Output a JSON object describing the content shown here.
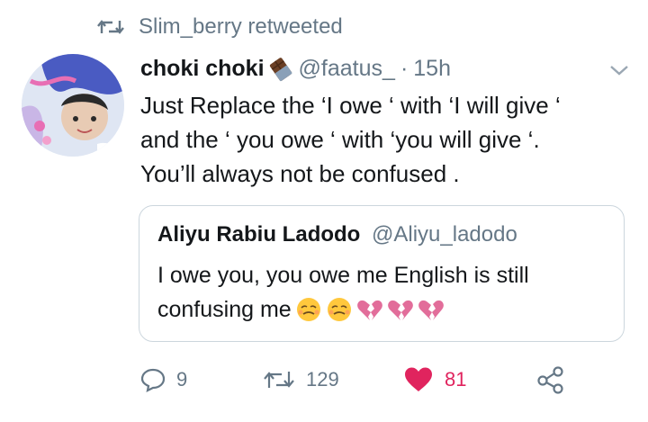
{
  "retweet_banner": {
    "text": "Slim_berry retweeted"
  },
  "tweet": {
    "author_name": "choki choki",
    "author_emoji": "chocolate-bar-icon",
    "handle": "@faatus_",
    "separator": "·",
    "time": "15h",
    "text_lines": [
      "Just Replace the ‘I owe ‘ with ‘I will give ‘",
      "and the ‘ you owe ‘ with ‘you will give ‘.",
      "You’ll always not be confused ."
    ]
  },
  "quoted_tweet": {
    "author_name": "Aliyu Rabiu Ladodo",
    "handle": "@Aliyu_ladodo",
    "text_line_1": "I owe you, you owe me English is still",
    "text_line_2": "confusing me",
    "emojis": [
      "pleading-face-icon",
      "pleading-face-icon",
      "broken-heart-icon",
      "broken-heart-icon",
      "broken-heart-icon"
    ]
  },
  "actions": {
    "reply_count": "9",
    "retweet_count": "129",
    "like_count": "81"
  },
  "colors": {
    "secondary_text": "#657786",
    "like_red": "#e0245e",
    "border": "#ccd6dd",
    "broken_heart": "#e26d9a",
    "pleading_face": "#ffc83d"
  }
}
